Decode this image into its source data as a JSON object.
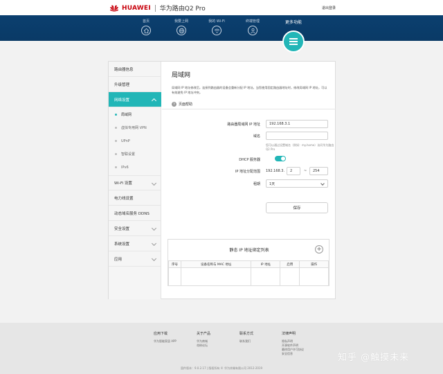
{
  "header": {
    "brand": "HUAWEI",
    "product": "华为路由Q2 Pro",
    "logout": "退出登录"
  },
  "nav": {
    "items": [
      {
        "label": "首页",
        "icon": "home-icon"
      },
      {
        "label": "我要上网",
        "icon": "globe-icon"
      },
      {
        "label": "我的 Wi-Fi",
        "icon": "wifi-icon"
      },
      {
        "label": "终端管理",
        "icon": "user-icon"
      }
    ],
    "more": {
      "label": "更多功能",
      "icon": "menu-icon"
    }
  },
  "sidebar": {
    "items": [
      {
        "label": "路由器信息"
      },
      {
        "label": "升级管理"
      },
      {
        "label": "网络设置"
      },
      {
        "label": "Wi-Fi 设置"
      },
      {
        "label": "电力线设置"
      },
      {
        "label": "动态域名服务 DDNS"
      },
      {
        "label": "安全设置"
      },
      {
        "label": "系统设置"
      },
      {
        "label": "应用"
      }
    ],
    "sub_items": [
      {
        "label": "局域网"
      },
      {
        "label": "虚拟专用网 VPN"
      },
      {
        "label": "UPnP"
      },
      {
        "label": "智联设置"
      },
      {
        "label": "IPv6"
      }
    ]
  },
  "content": {
    "title": "局域网",
    "description": "局域网 IP 地址修改后，连接到路由器的设备会重新分配 IP 地址。当您使用固定路由器地址时，修改局域网 IP 地址，可以有效避免 IP 地址冲突。",
    "help": "页面帮助",
    "form": {
      "ip_label": "路由器局域网 IP 地址",
      "ip_value": "192.168.3.1",
      "domain_label": "域名",
      "domain_value": "",
      "domain_hint": "您可以通过设置域名（例如：my.home）访问华为路由Q2 Pro",
      "dhcp_label": "DHCP 服务器",
      "range_label": "IP 地址分配范围",
      "range_prefix": "192.168.3.",
      "range_start": "2",
      "range_dash": "~",
      "range_end": "254",
      "lease_label": "租期",
      "lease_value": "1天",
      "save": "保存"
    },
    "static_table": {
      "title": "静态 IP 地址绑定列表",
      "add": "+",
      "columns": [
        "序号",
        "设备名称与 MAC 地址",
        "IP 地址",
        "启用",
        "操作"
      ]
    }
  },
  "footer": {
    "columns": [
      {
        "head": "应用下载",
        "links": [
          "华为智能家居 APP"
        ]
      },
      {
        "head": "关于产品",
        "links": [
          "华为商城",
          "花粉论坛"
        ]
      },
      {
        "head": "联系方式",
        "links": [
          "联系我们"
        ]
      },
      {
        "head": "法律声明",
        "links": [
          "隐私声明",
          "开源软件声明",
          "最终用户许可协议",
          "安全信息"
        ]
      }
    ],
    "copyright": "固件版本：9.0.2.17  |  版权所有 © 华为终端有限公司 2012-2019",
    "watermark": "知乎 @触摸未来"
  },
  "colors": {
    "accent": "#22b6b7",
    "nav_bg": "#0b3f6f",
    "brand_red": "#c7000b"
  }
}
